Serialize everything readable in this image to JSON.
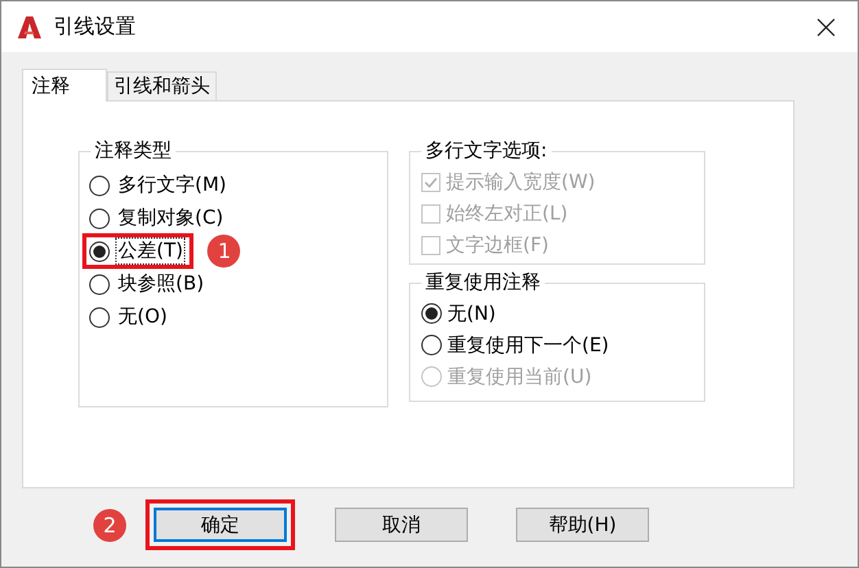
{
  "window": {
    "title": "引线设置"
  },
  "tabs": [
    {
      "label": "注释",
      "selected": true
    },
    {
      "label": "引线和箭头",
      "selected": false
    }
  ],
  "annotation_type": {
    "title": "注释类型",
    "options": [
      {
        "label": "多行文字(M)",
        "selected": false,
        "focused": false
      },
      {
        "label": "复制对象(C)",
        "selected": false,
        "focused": false
      },
      {
        "label": "公差(T)",
        "selected": true,
        "focused": true,
        "callout": "1"
      },
      {
        "label": "块参照(B)",
        "selected": false,
        "focused": false
      },
      {
        "label": "无(O)",
        "selected": false,
        "focused": false
      }
    ]
  },
  "mtext_options": {
    "title": "多行文字选项:",
    "items": [
      {
        "label": "提示输入宽度(W)",
        "checked": true,
        "disabled": true
      },
      {
        "label": "始终左对正(L)",
        "checked": false,
        "disabled": true
      },
      {
        "label": "文字边框(F)",
        "checked": false,
        "disabled": true
      }
    ]
  },
  "reuse_annotation": {
    "title": "重复使用注释",
    "options": [
      {
        "label": "无(N)",
        "selected": true,
        "disabled": false
      },
      {
        "label": "重复使用下一个(E)",
        "selected": false,
        "disabled": false
      },
      {
        "label": "重复使用当前(U)",
        "selected": false,
        "disabled": true
      }
    ]
  },
  "buttons": [
    {
      "label": "确定",
      "focused": true,
      "callout": "2"
    },
    {
      "label": "取消",
      "focused": false
    },
    {
      "label": "帮助(H)",
      "focused": false
    }
  ]
}
